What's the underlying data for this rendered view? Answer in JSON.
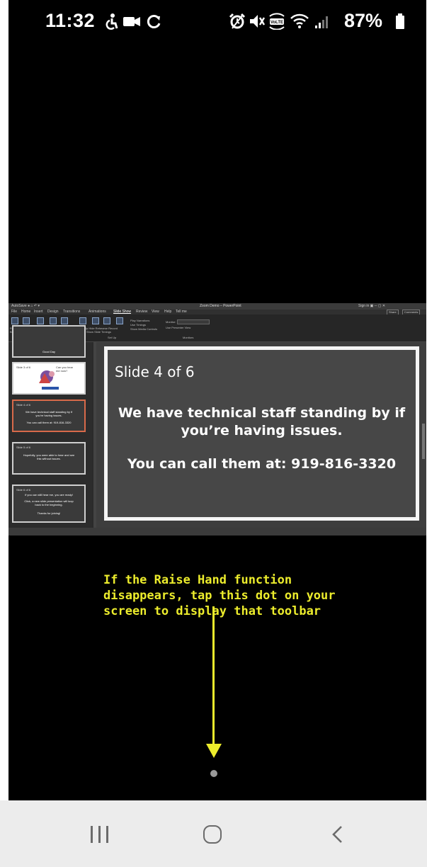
{
  "status_bar": {
    "time": "11:32",
    "battery": "87%",
    "left_icons": [
      "accessibility-icon",
      "video-camera-icon",
      "sync-icon"
    ],
    "right_icons": [
      "alarm-icon",
      "mute-icon",
      "volte-icon",
      "wifi-icon",
      "signal-icon",
      "battery-icon"
    ]
  },
  "shared_screen": {
    "slide": {
      "number_label": "Slide 4 of 6",
      "line1": "We have technical staff standing by if",
      "line2": "you’re having issues.",
      "line3": "You can call them at: 919-816-3320"
    }
  },
  "instruction": {
    "line1": "If the Raise Hand function",
    "line2": "disappears, tap this dot on your",
    "line3": "screen to display that toolbar",
    "color": "#ecec2c"
  },
  "nav_bar": {
    "buttons": [
      "recents-icon",
      "home-icon",
      "back-icon"
    ]
  }
}
